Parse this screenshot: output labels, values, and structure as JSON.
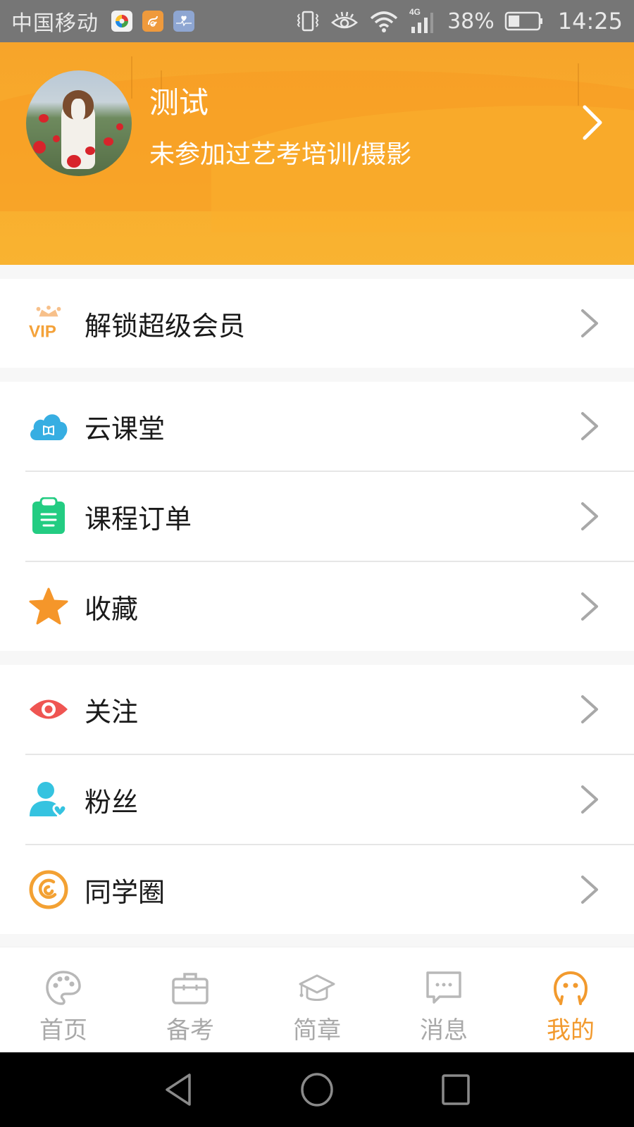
{
  "status_bar": {
    "carrier": "中国移动",
    "notification_icons": [
      "game-center-icon",
      "uc-browser-icon",
      "health-icon"
    ],
    "system_icons": [
      "vibrate-icon",
      "eye-comfort-icon",
      "wifi-icon",
      "signal-4g-icon",
      "battery-icon"
    ],
    "network_label": "4G",
    "battery_percent": "38%",
    "battery_level": 0.38,
    "time": "14:25"
  },
  "profile": {
    "name": "测试",
    "subtitle": "未参加过艺考培训/摄影",
    "avatar": "dog-in-poppy-field"
  },
  "menu": {
    "groups": [
      {
        "items": [
          {
            "label": "解锁超级会员",
            "icon": "vip-crown-icon"
          }
        ]
      },
      {
        "items": [
          {
            "label": "云课堂",
            "icon": "cloud-book-icon"
          },
          {
            "label": "课程订单",
            "icon": "clipboard-icon"
          },
          {
            "label": "收藏",
            "icon": "star-icon"
          }
        ]
      },
      {
        "items": [
          {
            "label": "关注",
            "icon": "eye-icon"
          },
          {
            "label": "粉丝",
            "icon": "fan-user-heart-icon"
          },
          {
            "label": "同学圈",
            "icon": "circle-swirl-icon"
          }
        ]
      }
    ],
    "vip_text": "VIP"
  },
  "tabbar": {
    "tabs": [
      {
        "label": "首页",
        "icon": "palette-icon",
        "active": false
      },
      {
        "label": "备考",
        "icon": "briefcase-icon",
        "active": false
      },
      {
        "label": "简章",
        "icon": "graduation-cap-icon",
        "active": false
      },
      {
        "label": "消息",
        "icon": "chat-bubble-icon",
        "active": false
      },
      {
        "label": "我的",
        "icon": "smiley-face-icon",
        "active": true
      }
    ],
    "active_color": "#f29a2e",
    "inactive_color": "#a9a9a9"
  },
  "colors": {
    "header_orange": "#f8ac2c",
    "vip_orange": "#f4a23a",
    "cloud_blue": "#37aee2",
    "clipboard_green": "#23cc82",
    "star_orange": "#f5962a",
    "eye_red": "#ef5552",
    "fans_cyan": "#35c3e0",
    "circle_orange": "#f3a133"
  }
}
